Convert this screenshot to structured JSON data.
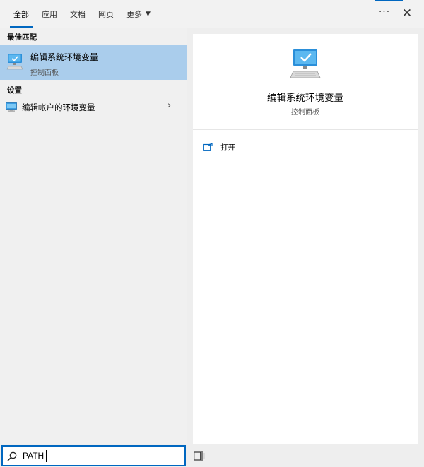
{
  "tabs": [
    {
      "label": "全部"
    },
    {
      "label": "应用"
    },
    {
      "label": "文档"
    },
    {
      "label": "网页"
    },
    {
      "label": "更多"
    }
  ],
  "window_controls": {
    "more_icon": "ellipsis-icon",
    "close_icon": "close-icon",
    "more_glyph": "···",
    "close_glyph": "✕"
  },
  "left_pane": {
    "best_match_title": "最佳匹配",
    "best_match": {
      "title": "编辑系统环境变量",
      "subtitle": "控制面板",
      "icon": "monitor-check-icon"
    },
    "settings_title": "设置",
    "settings_items": [
      {
        "label": "编辑帐户的环境变量",
        "icon": "monitor-icon",
        "chevron": "›"
      }
    ]
  },
  "right_pane": {
    "title": "编辑系统环境变量",
    "subtitle": "控制面板",
    "actions": [
      {
        "label": "打开",
        "icon": "open-icon"
      }
    ]
  },
  "search": {
    "value": "PATH",
    "icon": "search-icon"
  },
  "colors": {
    "accent": "#0067c0",
    "selected_row": "#aacdec"
  }
}
